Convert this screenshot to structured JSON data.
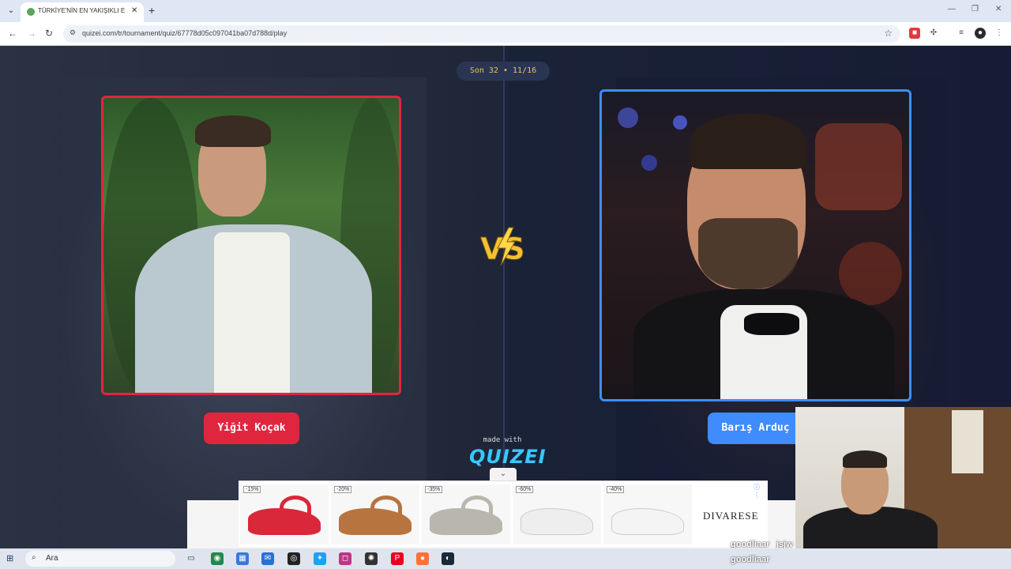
{
  "browser": {
    "tab_title": "TÜRKİYE'NİN EN YAKIŞIKLI ERKE",
    "url": "quizei.com/tr/tournament/quiz/67778d05c097041ba07d788d/play"
  },
  "quiz": {
    "round_label": "Son 32 • 11/16",
    "left_name": "Yiğit Koçak",
    "right_name": "Barış Arduç",
    "vs_label": "VS",
    "made_with": "made with",
    "brand_logo": "QUIZEI"
  },
  "ad": {
    "items": [
      {
        "discount": "-15%",
        "color": "#d8283a"
      },
      {
        "discount": "-20%",
        "color": "#b8743e"
      },
      {
        "discount": "-35%",
        "color": "#b9b6ad"
      },
      {
        "discount": "-60%",
        "color": "#eeeeee"
      },
      {
        "discount": "-40%",
        "color": "#f4f4f4"
      }
    ],
    "brand": "DIVARESE"
  },
  "stream": {
    "chat": [
      {
        "user": "goodliaar",
        "text": "jsjw"
      },
      {
        "user": "goodliaar",
        "text": "👍"
      }
    ]
  },
  "taskbar": {
    "search_label": "Ara"
  },
  "colors": {
    "left_accent": "#e0263f",
    "right_accent": "#3f8cff",
    "round_text": "#e8c35a"
  }
}
